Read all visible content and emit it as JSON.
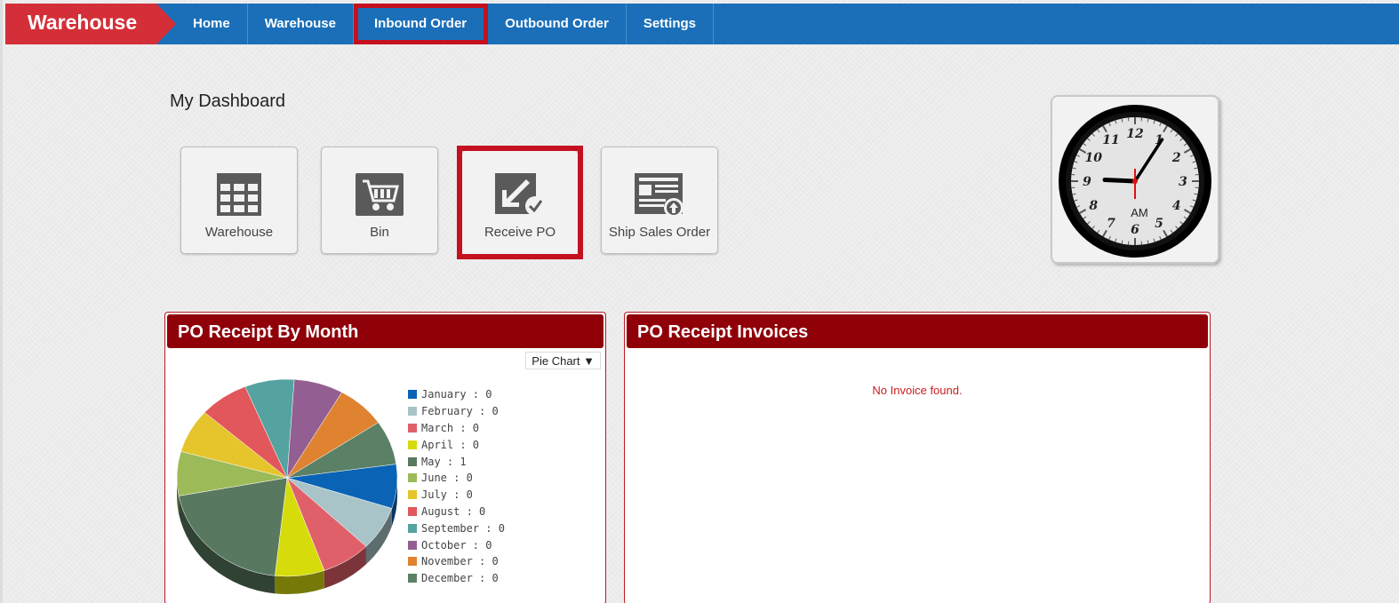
{
  "topbar": {
    "brand": "Warehouse",
    "nav": [
      "Home",
      "Warehouse",
      "Inbound Order",
      "Outbound Order",
      "Settings"
    ]
  },
  "dashboard": {
    "title": "My Dashboard",
    "tiles": [
      "Warehouse",
      "Bin",
      "Receive PO",
      "Ship Sales Order"
    ]
  },
  "clock": {
    "hour": 9,
    "minute": 5,
    "second": 30,
    "period": "AM"
  },
  "panels": {
    "receipts_title": "PO Receipt By Month",
    "chart_selector": "Pie Chart",
    "invoices_title": "PO Receipt Invoices",
    "no_invoice": "No Invoice found."
  },
  "chart_data": {
    "type": "pie",
    "categories": [
      "January",
      "February",
      "March",
      "April",
      "May",
      "June",
      "July",
      "August",
      "September",
      "October",
      "November",
      "December"
    ],
    "values": [
      0,
      0,
      0,
      0,
      1,
      0,
      0,
      0,
      0,
      0,
      0,
      0
    ],
    "colors": [
      "#0a63b5",
      "#a9c4c9",
      "#e0606a",
      "#d6dc0c",
      "#58785f",
      "#9dba58",
      "#e6c42c",
      "#e2575b",
      "#54a3a0",
      "#935f92",
      "#df8330",
      "#5a8066"
    ],
    "separator": " : "
  }
}
